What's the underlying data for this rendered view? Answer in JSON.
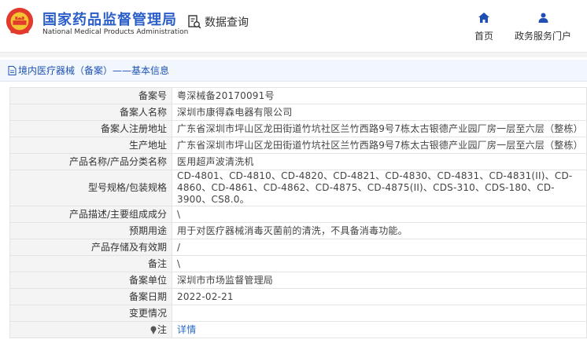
{
  "header": {
    "title_cn": "国家药品监督管理局",
    "title_en": "National Medical Products Administration",
    "query_label": "数据查询",
    "nav": [
      {
        "label": "首页"
      },
      {
        "label": "政务服务门户"
      }
    ]
  },
  "panel": {
    "title": "境内医疗器械（备案）——基本信息"
  },
  "rows": [
    {
      "key": "备案号",
      "value": "粤深械备20170091号"
    },
    {
      "key": "备案人名称",
      "value": "深圳市康得森电器有限公司"
    },
    {
      "key": "备案人注册地址",
      "value": "广东省深圳市坪山区龙田街道竹坑社区兰竹西路9号7栋太古银德产业园厂房一层至六层（整栋）"
    },
    {
      "key": "生产地址",
      "value": "广东省深圳市坪山区龙田街道竹坑社区兰竹西路9号7栋太古银德产业园厂房一层至六层（整栋）"
    },
    {
      "key": "产品名称/产品分类名称",
      "value": "医用超声波清洗机"
    },
    {
      "key": "型号规格/包装规格",
      "value": "CD-4801、CD-4810、CD-4820、CD-4821、CD-4830、CD-4831、CD-4831(II)、CD-4860、CD-4861、CD-4862、CD-4875、CD-4875(II)、CDS-310、CDS-180、CD-3900、CS8.0。"
    },
    {
      "key": "产品描述/主要组成成分",
      "value": "\\"
    },
    {
      "key": "预期用途",
      "value": "用于对医疗器械消毒灭菌前的清洗，不具备消毒功能。"
    },
    {
      "key": "产品存储及有效期",
      "value": "/"
    },
    {
      "key": "备注",
      "value": "\\"
    },
    {
      "key": "备案单位",
      "value": "深圳市市场监督管理局"
    },
    {
      "key": "备案日期",
      "value": "2022-02-21"
    },
    {
      "key": "变更情况",
      "value": ""
    },
    {
      "key": "注",
      "value": "详情"
    }
  ],
  "colors": {
    "brand": "#2b5ec8",
    "link": "#2b6cc4",
    "key_bg": "#f4f4f4",
    "title_bg": "#f2f7fd"
  },
  "icons": [
    "national-emblem-icon",
    "search-doc-icon",
    "home-icon",
    "user-icon",
    "document-icon",
    "pin-icon"
  ]
}
